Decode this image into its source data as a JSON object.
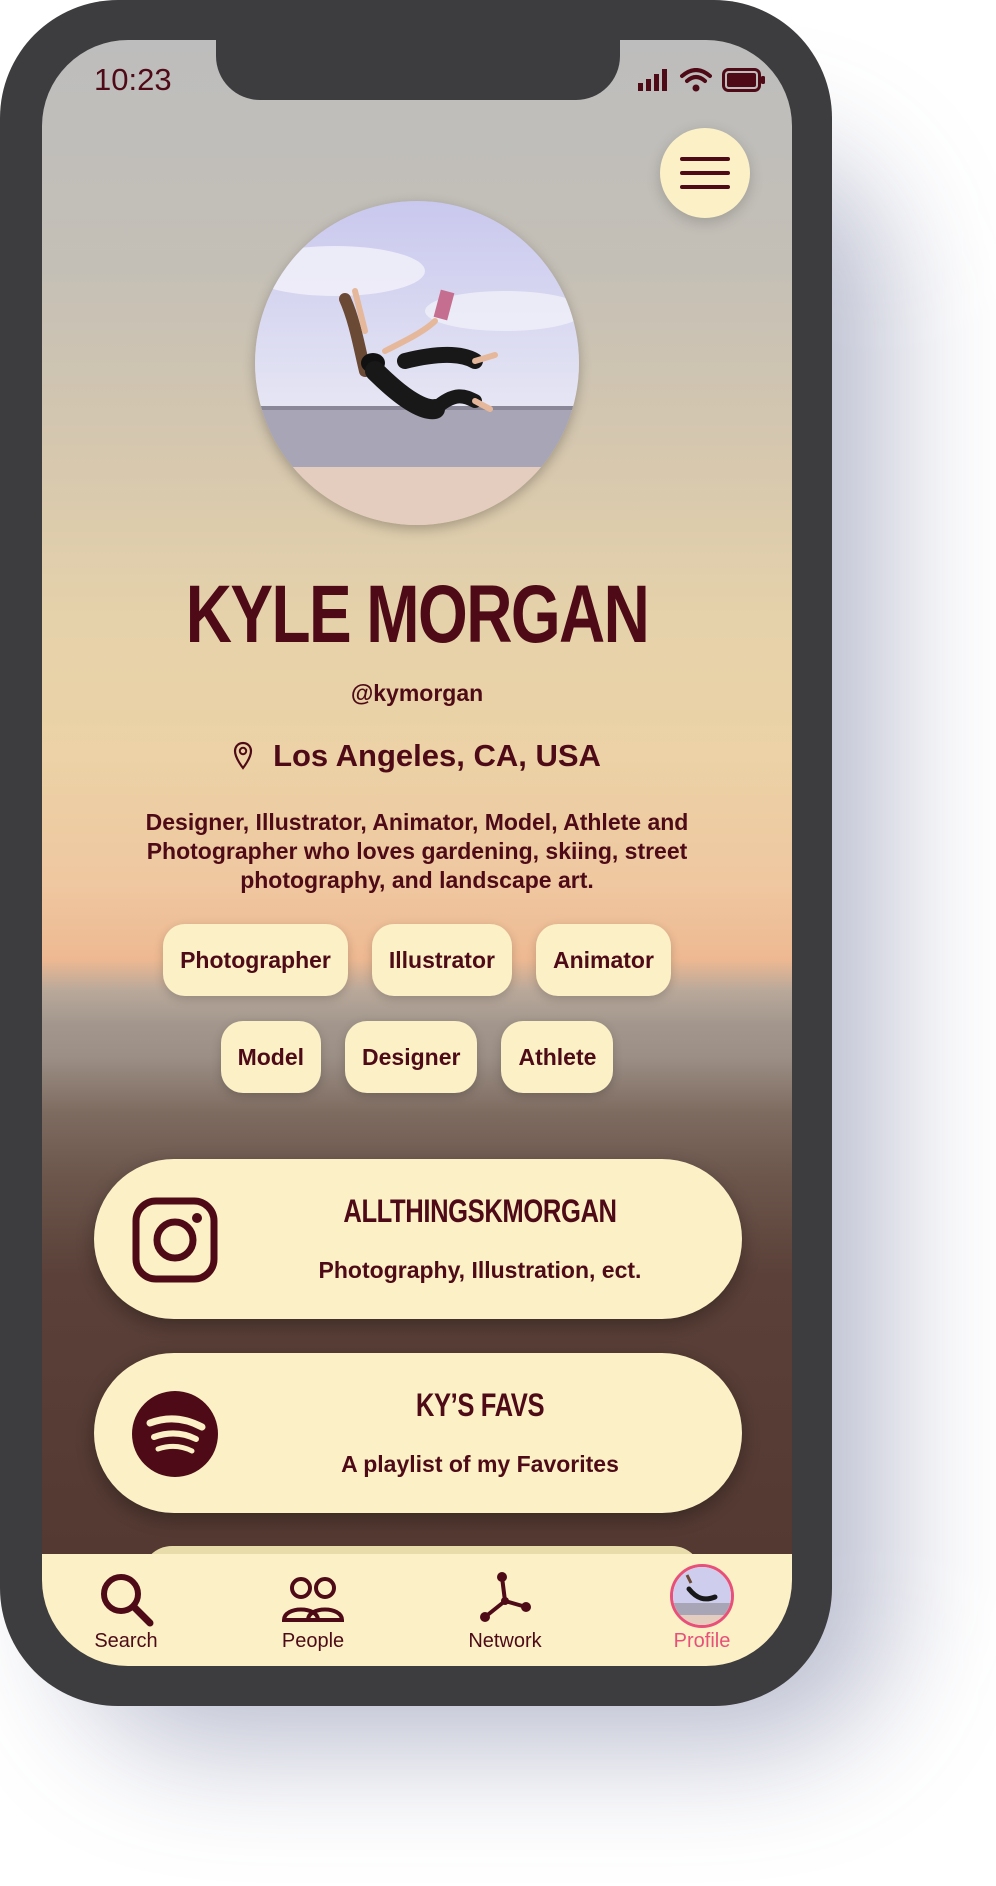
{
  "status_bar": {
    "time": "10:23"
  },
  "profile": {
    "name": "KYLE MORGAN",
    "handle": "@kymorgan",
    "location": "Los Angeles, CA, USA",
    "bio": "Designer, Illustrator, Animator, Model, Athlete and Photographer who loves gardening, skiing, street photography, and landscape art."
  },
  "tags_row1": [
    "Photographer",
    "Illustrator",
    "Animator"
  ],
  "tags_row2": [
    "Model",
    "Designer",
    "Athlete"
  ],
  "links": [
    {
      "icon": "instagram-icon",
      "title": "ALLTHINGSKMORGAN",
      "subtitle": "Photography, Illustration, ect."
    },
    {
      "icon": "spotify-icon",
      "title": "KY’S FAVS",
      "subtitle": "A playlist of my Favorites"
    }
  ],
  "tabbar": {
    "items": [
      {
        "icon": "search-icon",
        "label": "Search"
      },
      {
        "icon": "people-icon",
        "label": "People"
      },
      {
        "icon": "network-icon",
        "label": "Network"
      },
      {
        "icon": "avatar",
        "label": "Profile",
        "active": true
      }
    ]
  },
  "colors": {
    "accent": "#4e0b17",
    "card": "#fbf0c6",
    "active_tab": "#e8507a"
  }
}
